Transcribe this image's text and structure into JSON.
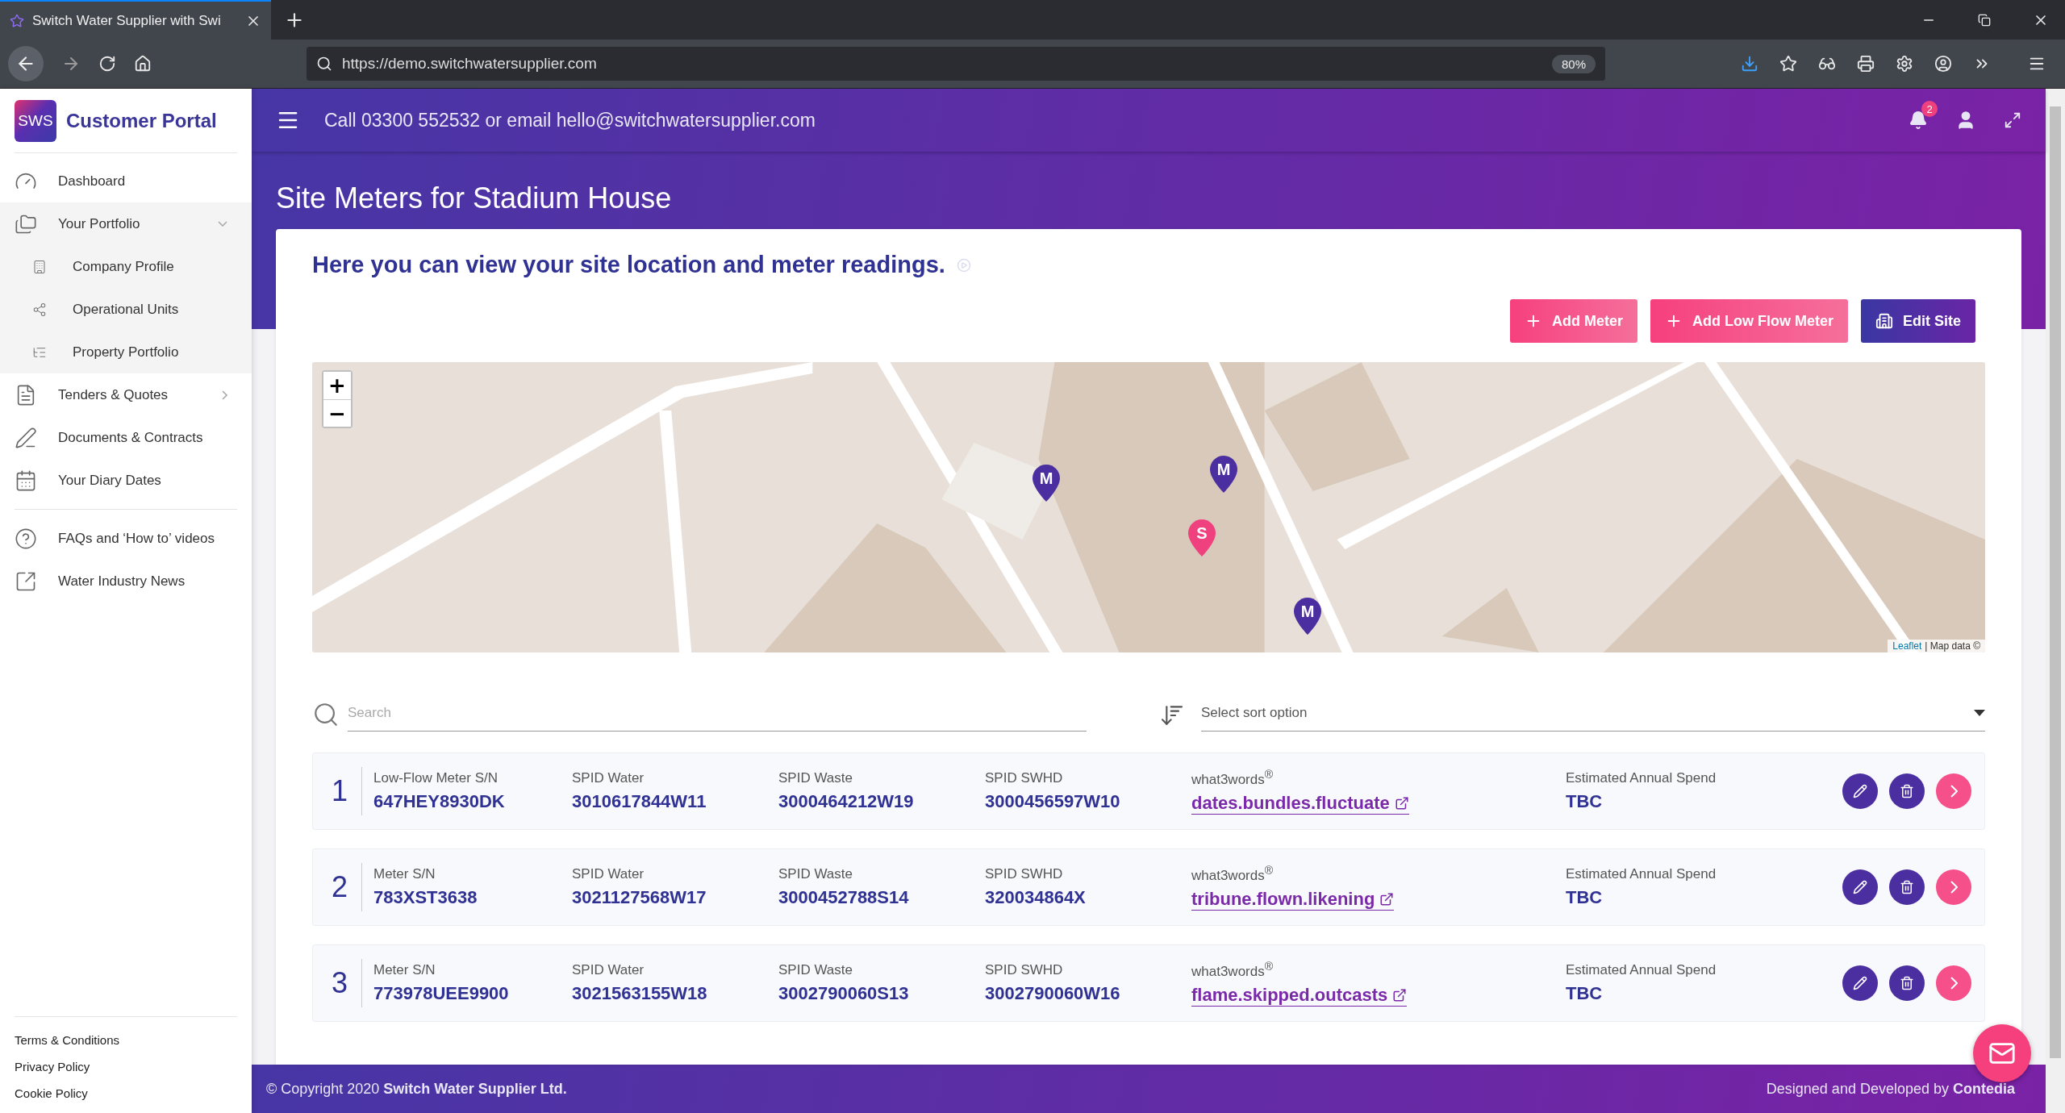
{
  "browser": {
    "tab_title": "Switch Water Supplier with Swi",
    "url": "https://demo.switchwatersupplier.com",
    "zoom": "80%"
  },
  "sidebar": {
    "logo": "SWS",
    "brand": "Customer Portal",
    "items": [
      {
        "kind": "link",
        "label": "Dashboard"
      },
      {
        "kind": "group",
        "label": "Your Portfolio",
        "expanded": true,
        "children": [
          {
            "label": "Company Profile"
          },
          {
            "label": "Operational Units"
          },
          {
            "label": "Property Portfolio"
          }
        ]
      },
      {
        "kind": "group",
        "label": "Tenders & Quotes",
        "expanded": false
      },
      {
        "kind": "link",
        "label": "Documents & Contracts"
      },
      {
        "kind": "link",
        "label": "Your Diary Dates"
      },
      {
        "kind": "divider"
      },
      {
        "kind": "link",
        "label": "FAQs and ‘How to’ videos"
      },
      {
        "kind": "link",
        "label": "Water Industry News"
      }
    ],
    "footer_links": [
      "Terms & Conditions",
      "Privacy Policy",
      "Cookie Policy"
    ]
  },
  "header": {
    "contact": "Call 03300 552532 or email hello@switchwatersupplier.com",
    "notifications": "2"
  },
  "page": {
    "title": "Site Meters for Stadium House",
    "intro": "Here you can view your site location and meter readings.",
    "buttons": [
      {
        "kind": "primary",
        "label": "Add Meter"
      },
      {
        "kind": "primary",
        "label": "Add Low Flow Meter"
      },
      {
        "kind": "secondary",
        "label": "Edit Site"
      }
    ]
  },
  "map": {
    "zoom_in": "+",
    "zoom_out": "−",
    "attribution_link": "Leaflet",
    "attribution": "| Map data ©",
    "markers": [
      {
        "label": "M",
        "color": "#4b2fa0"
      },
      {
        "label": "M",
        "color": "#4b2fa0"
      },
      {
        "label": "S",
        "color": "#f0417f"
      },
      {
        "label": "M",
        "color": "#4b2fa0"
      }
    ]
  },
  "filters": {
    "search_placeholder": "Search",
    "sort_placeholder": "Select sort option"
  },
  "meters": [
    {
      "number": "1",
      "fields": [
        {
          "label": "Low-Flow Meter S/N",
          "value": "647HEY8930DK"
        },
        {
          "label": "SPID Water",
          "value": "3010617844W11"
        },
        {
          "label": "SPID Waste",
          "value": "3000464212W19"
        },
        {
          "label": "SPID SWHD",
          "value": "3000456597W10"
        }
      ],
      "w3w_label": "what3words$^{®}$",
      "w3w": "dates.bundles.fluctuate",
      "spend_label": "Estimated Annual Spend",
      "spend": "TBC"
    },
    {
      "number": "2",
      "fields": [
        {
          "label": "Meter S/N",
          "value": "783XST3638"
        },
        {
          "label": "SPID Water",
          "value": "3021127568W17"
        },
        {
          "label": "SPID Waste",
          "value": "3000452788S14"
        },
        {
          "label": "SPID SWHD",
          "value": "320034864X"
        }
      ],
      "w3w_label": "what3words$^{®}$",
      "w3w": "tribune.flown.likening",
      "spend_label": "Estimated Annual Spend",
      "spend": "TBC"
    },
    {
      "number": "3",
      "fields": [
        {
          "label": "Meter S/N",
          "value": "773978UEE9900"
        },
        {
          "label": "SPID Water",
          "value": "3021563155W18"
        },
        {
          "label": "SPID Waste",
          "value": "3002790060S13"
        },
        {
          "label": "SPID SWHD",
          "value": "3002790060W16"
        }
      ],
      "w3w_label": "what3words$^{®}$",
      "w3w": "flame.skipped.outcasts",
      "spend_label": "Estimated Annual Spend",
      "spend": "TBC"
    }
  ],
  "footer": {
    "copyright": "© Copyright 2020 **Switch Water Supplier Ltd.**",
    "credit": "Designed and Developed by **Contedia**"
  }
}
